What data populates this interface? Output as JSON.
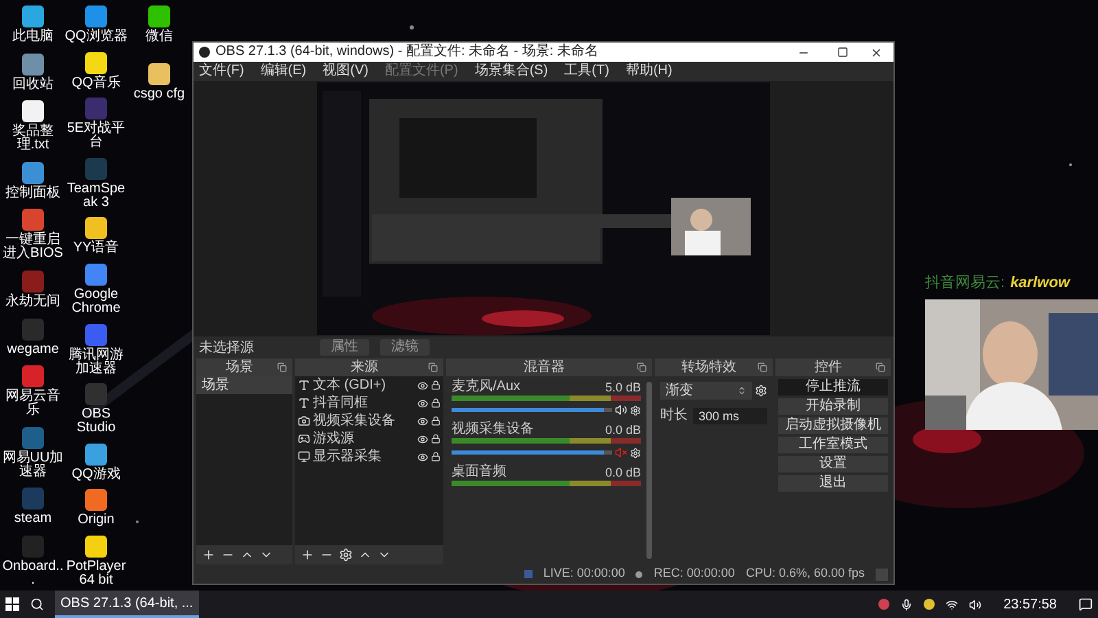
{
  "desktop": {
    "columns": [
      [
        {
          "label": "此电脑",
          "color": "#2aa7e0"
        },
        {
          "label": "回收站",
          "color": "#6f8fa8"
        },
        {
          "label": "奖品整理.txt",
          "color": "#f2f2f2"
        },
        {
          "label": "控制面板",
          "color": "#3b8fd4"
        },
        {
          "label": "一键重启进入BIOS",
          "color": "#d9442e"
        },
        {
          "label": "永劫无间",
          "color": "#8a1c1c"
        },
        {
          "label": "wegame",
          "color": "#2a2a2a"
        },
        {
          "label": "网易云音乐",
          "color": "#d8222a"
        },
        {
          "label": "网易UU加速器",
          "color": "#1d5f8a"
        },
        {
          "label": "steam",
          "color": "#1b3a5c"
        },
        {
          "label": "Onboard...",
          "color": "#222222"
        }
      ],
      [
        {
          "label": "QQ浏览器",
          "color": "#1e90e8"
        },
        {
          "label": "QQ音乐",
          "color": "#f5d814"
        },
        {
          "label": "5E对战平台",
          "color": "#3a2c6e"
        },
        {
          "label": "TeamSpeak 3",
          "color": "#1c3a4e"
        },
        {
          "label": "YY语音",
          "color": "#f0c020"
        },
        {
          "label": "Google Chrome",
          "color": "#4285f4"
        },
        {
          "label": "腾讯网游加速器",
          "color": "#3a5cf0"
        },
        {
          "label": "OBS Studio",
          "color": "#303030"
        },
        {
          "label": "QQ游戏",
          "color": "#3aa0e0"
        },
        {
          "label": "Origin",
          "color": "#f06a22"
        },
        {
          "label": "PotPlayer 64 bit",
          "color": "#f5d010"
        }
      ],
      [
        {
          "label": "微信",
          "color": "#2dc100"
        },
        {
          "label": "csgo cfg",
          "color": "#e8c060"
        }
      ]
    ]
  },
  "obs": {
    "title": "OBS 27.1.3 (64-bit, windows) - 配置文件: 未命名 - 场景: 未命名",
    "menu": [
      {
        "label": "文件(F)",
        "disabled": false
      },
      {
        "label": "编辑(E)",
        "disabled": false
      },
      {
        "label": "视图(V)",
        "disabled": false
      },
      {
        "label": "配置文件(P)",
        "disabled": true
      },
      {
        "label": "场景集合(S)",
        "disabled": false
      },
      {
        "label": "工具(T)",
        "disabled": false
      },
      {
        "label": "帮助(H)",
        "disabled": false
      }
    ],
    "source_bar": {
      "label": "未选择源",
      "buttons": [
        "属性",
        "滤镜"
      ]
    },
    "scenes": {
      "title": "场景",
      "items": [
        {
          "label": "场景",
          "selected": true
        }
      ]
    },
    "sources": {
      "title": "来源",
      "items": [
        {
          "label": "文本 (GDI+)",
          "kind": "text"
        },
        {
          "label": "抖音同框",
          "kind": "text"
        },
        {
          "label": "视频采集设备",
          "kind": "camera"
        },
        {
          "label": "游戏源",
          "kind": "game"
        },
        {
          "label": "显示器采集",
          "kind": "monitor"
        }
      ]
    },
    "mixer": {
      "title": "混音器",
      "channels": [
        {
          "name": "麦克风/Aux",
          "reading": "5.0 dB",
          "muted": false,
          "level": 0.95
        },
        {
          "name": "视频采集设备",
          "reading": "0.0 dB",
          "muted": true,
          "level": 0.95
        },
        {
          "name": "桌面音频",
          "reading": "0.0 dB"
        }
      ]
    },
    "transitions": {
      "title": "转场特效",
      "type": "渐变",
      "duration_label": "时长",
      "duration": "300 ms"
    },
    "controls": {
      "title": "控件",
      "buttons": [
        {
          "label": "停止推流",
          "active": true
        },
        {
          "label": "开始录制",
          "active": false
        },
        {
          "label": "启动虚拟摄像机",
          "active": false
        },
        {
          "label": "工作室模式",
          "active": false
        },
        {
          "label": "设置",
          "active": false
        },
        {
          "label": "退出",
          "active": false
        }
      ]
    },
    "status": {
      "live": "LIVE: 00:00:00",
      "rec": "REC: 00:00:00",
      "cpu": "CPU: 0.6%, 60.00 fps"
    }
  },
  "overlay": {
    "label": "抖音网易云:",
    "name": "karlwow"
  },
  "taskbar": {
    "task": "OBS 27.1.3 (64-bit, ...",
    "time": "23:57:58"
  }
}
